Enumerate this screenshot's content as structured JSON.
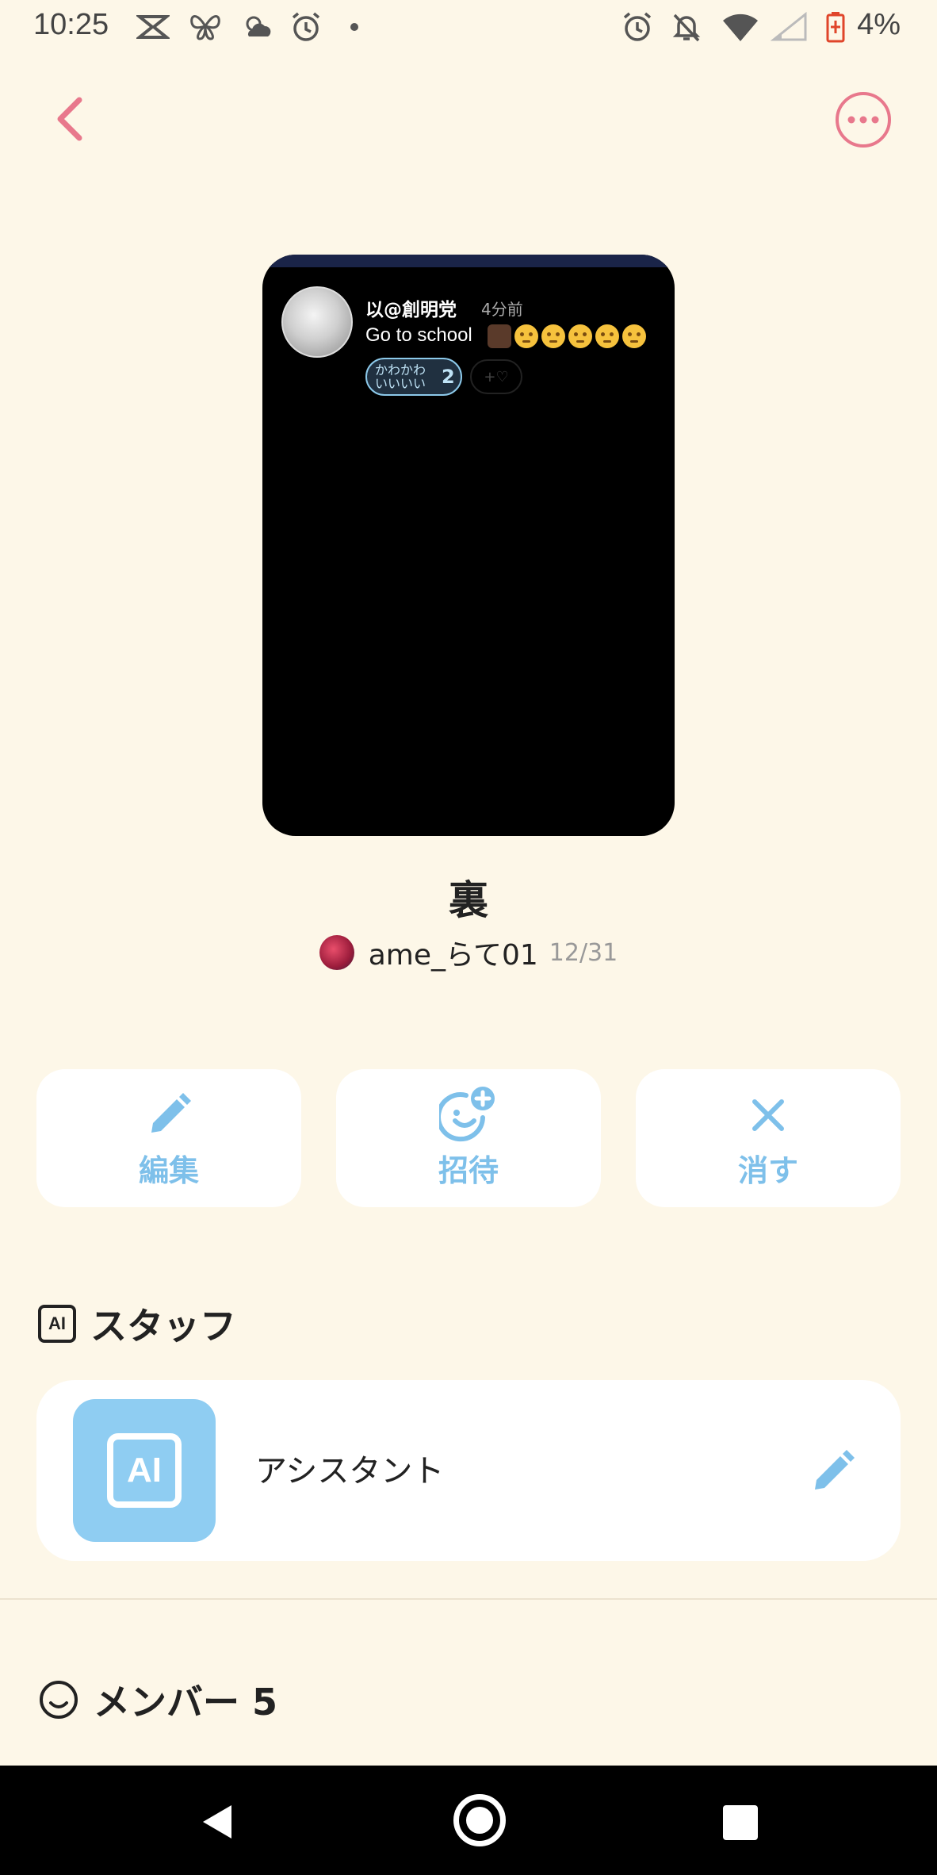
{
  "status_bar": {
    "time": "10:25",
    "battery": "4%",
    "left_icons": [
      "capcut-icon",
      "butterfly-icon",
      "weather-icon",
      "alarm-icon",
      "dot-icon"
    ],
    "right_icons": [
      "alarm-icon",
      "bell-off-icon",
      "wifi-icon",
      "signal-icon",
      "battery-icon"
    ]
  },
  "header": {
    "back_icon": "chevron-left-icon",
    "more_icon": "more-horizontal-icon",
    "accent_color": "#e8788c"
  },
  "preview": {
    "username": "以@創明党",
    "time_ago": "4分前",
    "message": "Go to school",
    "reaction_label": "かわかわ いいいい",
    "reaction_count": "2",
    "add_reaction": "+♡"
  },
  "room": {
    "title": "裏",
    "owner_name": "ame_らて01",
    "date": "12/31"
  },
  "actions": [
    {
      "label": "編集",
      "icon": "pencil-icon"
    },
    {
      "label": "招待",
      "icon": "invite-smile-icon"
    },
    {
      "label": "消す",
      "icon": "close-icon"
    }
  ],
  "staff": {
    "heading": "スタッフ",
    "badge": "AI",
    "item_name": "アシスタント",
    "tile_label": "AI"
  },
  "members": {
    "heading": "メンバー 5"
  },
  "colors": {
    "background": "#fdf7e8",
    "action_blue": "#7ec0ea",
    "ai_tile": "#8fcdf2"
  }
}
